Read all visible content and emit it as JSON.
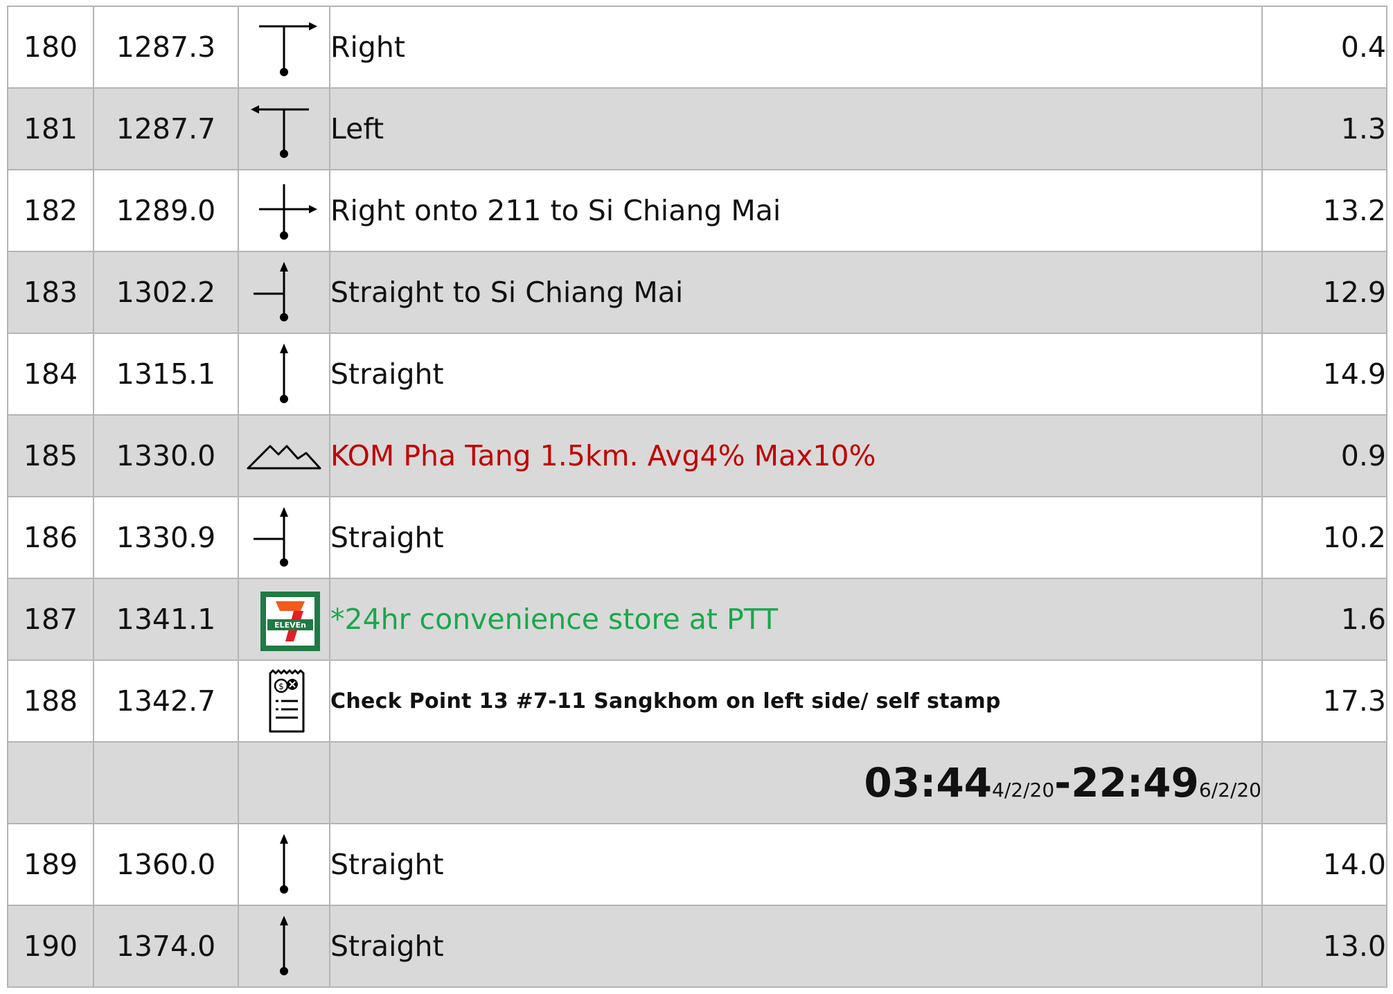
{
  "colors": {
    "row_shade": "#d9d9d9",
    "grid": "#b4b4b4",
    "kom_text": "#c00000",
    "store_text": "#19a84a",
    "seven_eleven_green": "#1f7a44",
    "seven_eleven_orange": "#f25a1d",
    "seven_eleven_red": "#e21d25"
  },
  "rows": [
    {
      "num": "180",
      "dist": "1287.3",
      "icon": "turn-right-icon",
      "desc": "Right",
      "seg": "0.4"
    },
    {
      "num": "181",
      "dist": "1287.7",
      "icon": "turn-left-icon",
      "desc": "Left",
      "seg": "1.3"
    },
    {
      "num": "182",
      "dist": "1289.0",
      "icon": "crossroad-right-icon",
      "desc": "Right onto 211 to Si Chiang Mai",
      "seg": "13.2"
    },
    {
      "num": "183",
      "dist": "1302.2",
      "icon": "straight-junction-left-icon",
      "desc": "Straight to Si Chiang Mai",
      "seg": "12.9"
    },
    {
      "num": "184",
      "dist": "1315.1",
      "icon": "straight-icon",
      "desc": "Straight",
      "seg": "14.9"
    },
    {
      "num": "185",
      "dist": "1330.0",
      "icon": "mountain-icon",
      "desc": "KOM Pha Tang 1.5km. Avg4% Max10%",
      "seg": "0.9"
    },
    {
      "num": "186",
      "dist": "1330.9",
      "icon": "straight-junction-left-icon",
      "desc": "Straight",
      "seg": "10.2"
    },
    {
      "num": "187",
      "dist": "1341.1",
      "icon": "seven-eleven-logo",
      "desc": "*24hr convenience store at PTT",
      "seg": "1.6"
    },
    {
      "num": "188",
      "dist": "1342.7",
      "icon": "receipt-icon",
      "desc": "Check Point 13 #7-11 Sangkhom on left side/ self stamp",
      "seg": "17.3"
    },
    {
      "num": "189",
      "dist": "1360.0",
      "icon": "straight-icon",
      "desc": "Straight",
      "seg": "14.0"
    },
    {
      "num": "190",
      "dist": "1374.0",
      "icon": "straight-icon",
      "desc": "Straight",
      "seg": "13.0"
    }
  ],
  "checkpoint_time": {
    "open_time": "03:44",
    "open_date": "4/2/20",
    "separator": "-",
    "close_time": "22:49",
    "close_date": "6/2/20"
  }
}
